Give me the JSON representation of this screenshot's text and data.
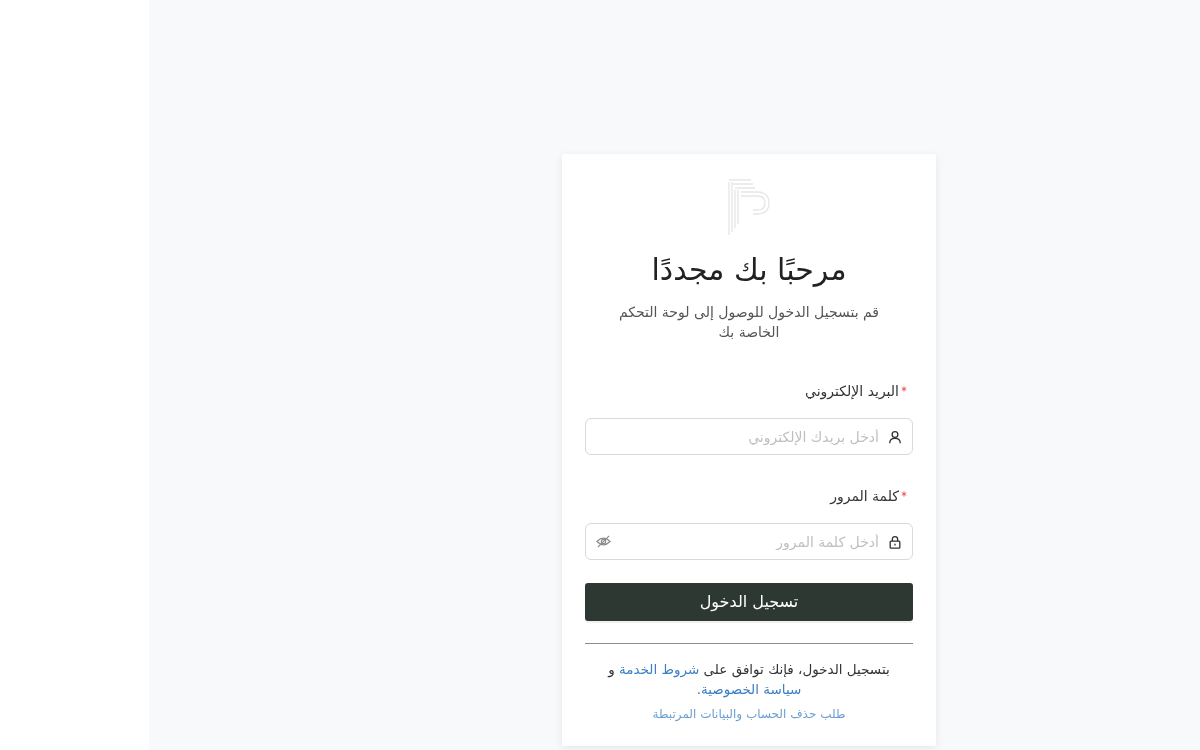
{
  "card": {
    "title": "مرحبًا بك مجددًا",
    "subtitle": "قم بتسجيل الدخول للوصول إلى لوحة التحكم الخاصة بك"
  },
  "fields": [
    {
      "kind": "email",
      "label": "البريد الإلكتروني",
      "required": true,
      "placeholder": "أدخل بريدك الإلكتروني"
    },
    {
      "kind": "password",
      "label": "كلمة المرور",
      "required": true,
      "placeholder": "أدخل كلمة المرور",
      "password_visible": false
    }
  ],
  "submit_button": "تسجيل الدخول",
  "terms": [
    {
      "kind": "text",
      "text": "بتسجيل الدخول، فإنك توافق على "
    },
    {
      "kind": "link",
      "text": "شروط الخدمة"
    },
    {
      "kind": "text",
      "text": " و "
    },
    {
      "kind": "link",
      "text": "سياسة الخصوصية."
    }
  ],
  "delete_account_link": "طلب حذف الحساب والبيانات المرتبطة"
}
